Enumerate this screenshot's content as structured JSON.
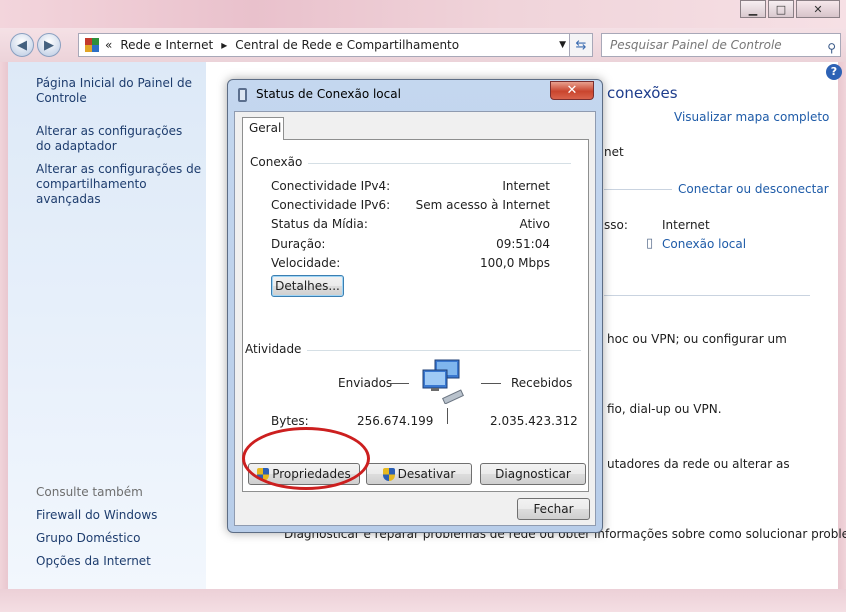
{
  "window": {
    "minimize": "▁",
    "maximize": "□",
    "close": "✕"
  },
  "address": {
    "chevron": "«",
    "crumbs": [
      "Rede e Internet",
      "Central de Rede e Compartilhamento"
    ],
    "search_placeholder": "Pesquisar Painel de Controle"
  },
  "sidebar": {
    "links": [
      "Página Inicial do Painel de Controle",
      "Alterar as configurações do adaptador",
      "Alterar as configurações de compartilhamento avançadas"
    ],
    "see_also_label": "Consulte também",
    "see_also": [
      "Firewall do Windows",
      "Grupo Doméstico",
      "Opções da Internet"
    ]
  },
  "background": {
    "heading_fragment": "conexões",
    "view_map": "Visualizar mapa completo",
    "net_fragment": "net",
    "connect_disconnect": "Conectar ou desconectar",
    "access_fragment": "sso:",
    "access_value": "Internet",
    "connection_link": "Conexão local",
    "line1": "hoc ou VPN; ou configurar um",
    "line2": "fio, dial-up ou VPN.",
    "line3": "utadores da rede ou alterar as",
    "line4": "Diagnosticar e reparar problemas de rede ou obter informações sobre como solucionar problemas."
  },
  "dialog": {
    "title": "Status de Conexão local",
    "close": "✕",
    "tab": "Geral",
    "connection_group": "Conexão",
    "rows": [
      {
        "label": "Conectividade IPv4:",
        "value": "Internet"
      },
      {
        "label": "Conectividade IPv6:",
        "value": "Sem acesso à Internet"
      },
      {
        "label": "Status da Mídia:",
        "value": "Ativo"
      },
      {
        "label": "Duração:",
        "value": "09:51:04"
      },
      {
        "label": "Velocidade:",
        "value": "100,0 Mbps"
      }
    ],
    "details_button": "Detalhes...",
    "activity_group": "Atividade",
    "sent_label": "Enviados",
    "received_label": "Recebidos",
    "bytes_label": "Bytes:",
    "bytes_sent": "256.674.199",
    "bytes_received": "2.035.423.312",
    "properties_button": "Propriedades",
    "disable_button": "Desativar",
    "diagnose_button": "Diagnosticar",
    "close_button": "Fechar"
  },
  "colors": {
    "annotation": "#cc1f1f",
    "link": "#1e3d6e"
  }
}
